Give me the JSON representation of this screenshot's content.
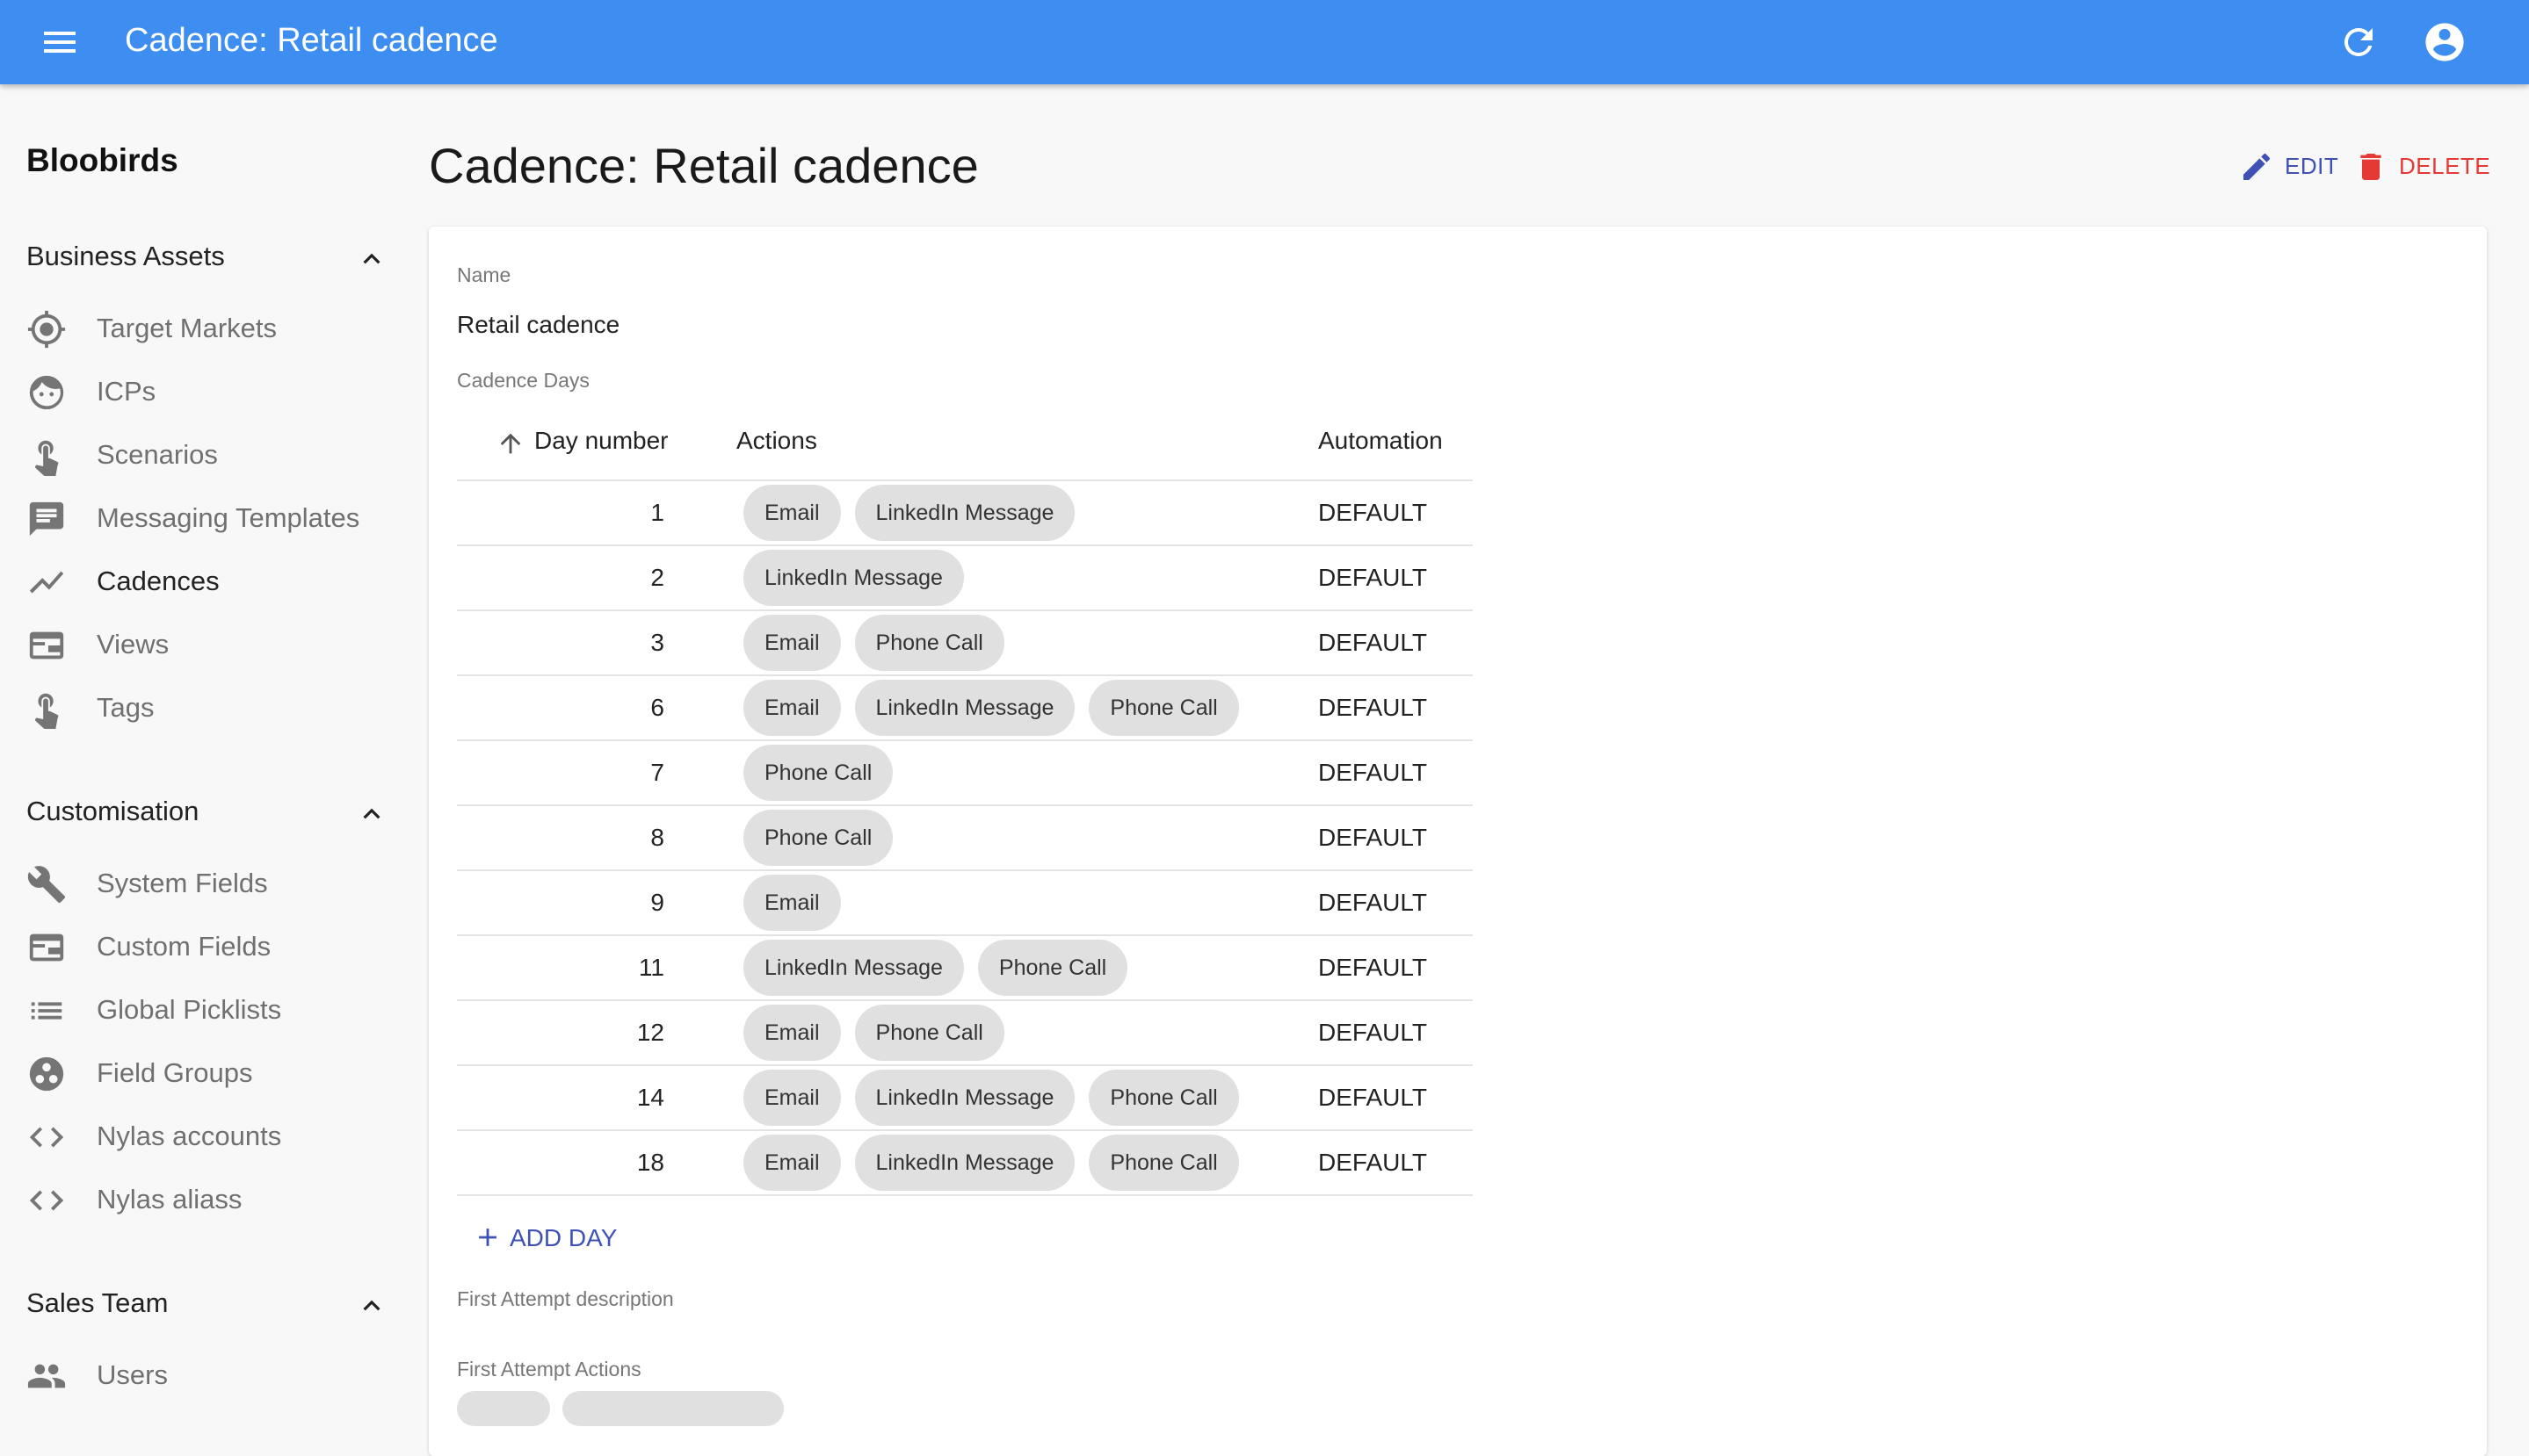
{
  "app_bar": {
    "title": "Cadence: Retail cadence",
    "background_color": "#3d8ef0",
    "icons": [
      "menu-icon",
      "refresh-icon",
      "account-circle-icon"
    ]
  },
  "sidebar": {
    "brand": "Bloobirds",
    "sections": [
      {
        "label": "Business Assets",
        "expanded": true,
        "items": [
          {
            "label": "Target Markets",
            "icon": "target-icon"
          },
          {
            "label": "ICPs",
            "icon": "face-icon"
          },
          {
            "label": "Scenarios",
            "icon": "touch-icon"
          },
          {
            "label": "Messaging Templates",
            "icon": "message-icon"
          },
          {
            "label": "Cadences",
            "icon": "trending-line-icon",
            "active": true
          },
          {
            "label": "Views",
            "icon": "view-window-icon"
          },
          {
            "label": "Tags",
            "icon": "touch-icon"
          }
        ]
      },
      {
        "label": "Customisation",
        "expanded": true,
        "items": [
          {
            "label": "System Fields",
            "icon": "wrench-icon"
          },
          {
            "label": "Custom Fields",
            "icon": "view-window-icon"
          },
          {
            "label": "Global Picklists",
            "icon": "list-icon"
          },
          {
            "label": "Field Groups",
            "icon": "group-circle-icon"
          },
          {
            "label": "Nylas accounts",
            "icon": "code-icon"
          },
          {
            "label": "Nylas aliass",
            "icon": "code-icon"
          }
        ]
      },
      {
        "label": "Sales Team",
        "expanded": true,
        "items": [
          {
            "label": "Users",
            "icon": "people-icon"
          }
        ]
      }
    ]
  },
  "main": {
    "title": "Cadence: Retail cadence",
    "edit_label": "EDIT",
    "delete_label": "DELETE",
    "accent_color": "#3f51b5",
    "danger_color": "#e53935",
    "name_label": "Name",
    "name_value": "Retail cadence",
    "cadence_days_label": "Cadence Days",
    "table": {
      "columns": [
        "Day number",
        "Actions",
        "Automation"
      ],
      "sort": "ascending",
      "rows": [
        {
          "day": "1",
          "actions": [
            "Email",
            "LinkedIn Message"
          ],
          "automation": "DEFAULT"
        },
        {
          "day": "2",
          "actions": [
            "LinkedIn Message"
          ],
          "automation": "DEFAULT"
        },
        {
          "day": "3",
          "actions": [
            "Email",
            "Phone Call"
          ],
          "automation": "DEFAULT"
        },
        {
          "day": "6",
          "actions": [
            "Email",
            "LinkedIn Message",
            "Phone Call"
          ],
          "automation": "DEFAULT"
        },
        {
          "day": "7",
          "actions": [
            "Phone Call"
          ],
          "automation": "DEFAULT"
        },
        {
          "day": "8",
          "actions": [
            "Phone Call"
          ],
          "automation": "DEFAULT"
        },
        {
          "day": "9",
          "actions": [
            "Email"
          ],
          "automation": "DEFAULT"
        },
        {
          "day": "11",
          "actions": [
            "LinkedIn Message",
            "Phone Call"
          ],
          "automation": "DEFAULT"
        },
        {
          "day": "12",
          "actions": [
            "Email",
            "Phone Call"
          ],
          "automation": "DEFAULT"
        },
        {
          "day": "14",
          "actions": [
            "Email",
            "LinkedIn Message",
            "Phone Call"
          ],
          "automation": "DEFAULT"
        },
        {
          "day": "18",
          "actions": [
            "Email",
            "LinkedIn Message",
            "Phone Call"
          ],
          "automation": "DEFAULT"
        }
      ]
    },
    "add_day_label": "ADD DAY",
    "first_attempt_description_label": "First Attempt description",
    "first_attempt_actions_label": "First Attempt Actions"
  }
}
